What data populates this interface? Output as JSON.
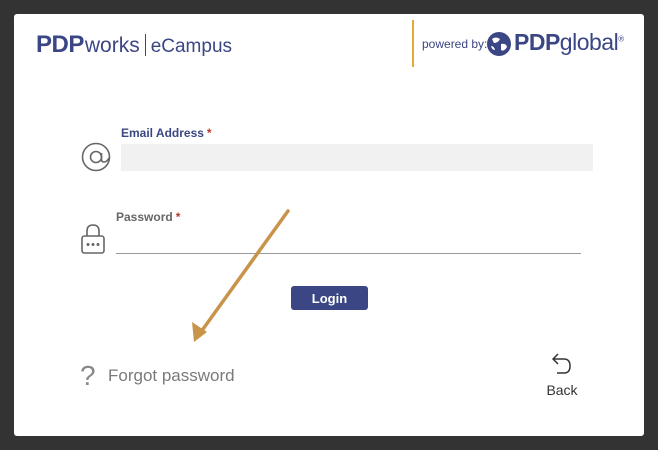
{
  "header": {
    "brand_bold": "PDP",
    "brand_light": "works",
    "brand_product": "eCampus",
    "powered_by": "powered by:",
    "partner_bold": "PDP",
    "partner_light": "global",
    "partner_reg": "®"
  },
  "form": {
    "email": {
      "label": "Email Address",
      "required_mark": "*",
      "value": "",
      "icon": "at-sign-icon"
    },
    "password": {
      "label": "Password",
      "required_mark": "*",
      "value": "",
      "icon": "lock-icon"
    },
    "login_label": "Login"
  },
  "footer": {
    "forgot_icon": "?",
    "forgot_label": "Forgot password",
    "back_label": "Back",
    "back_icon": "back-arrow-icon"
  },
  "colors": {
    "brand": "#3b4784",
    "accent": "#e4a93a",
    "required": "#b83a2e",
    "annotation_arrow": "#c8944a"
  }
}
